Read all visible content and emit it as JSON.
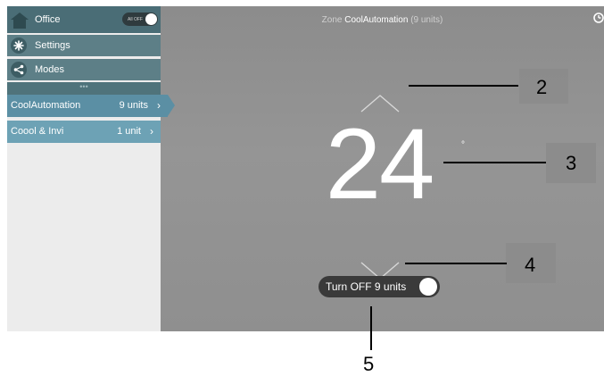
{
  "sidebar": {
    "office": {
      "label": "Office",
      "icon": "house-icon",
      "all_off_label": "All OFF"
    },
    "settings": {
      "label": "Settings",
      "icon": "gear-icon"
    },
    "modes": {
      "label": "Modes",
      "icon": "share-icon"
    },
    "more": "•••",
    "zones": [
      {
        "name": "CoolAutomation",
        "units": "9 units",
        "active": true
      },
      {
        "name": "Coool & Invi",
        "units": "1 unit",
        "active": false
      }
    ]
  },
  "header": {
    "prefix": "Zone",
    "zone_name": "CoolAutomation",
    "units": "(9 units)"
  },
  "thermostat": {
    "temperature": "24",
    "degree": "°"
  },
  "power": {
    "label": "Turn OFF 9 units",
    "state": "on"
  },
  "callouts": [
    "2",
    "3",
    "4",
    "5"
  ],
  "colors": {
    "sidebar_header": "#4a6d76",
    "active_zone": "#5b8fa4",
    "main_bg": "#8f8f8f"
  }
}
